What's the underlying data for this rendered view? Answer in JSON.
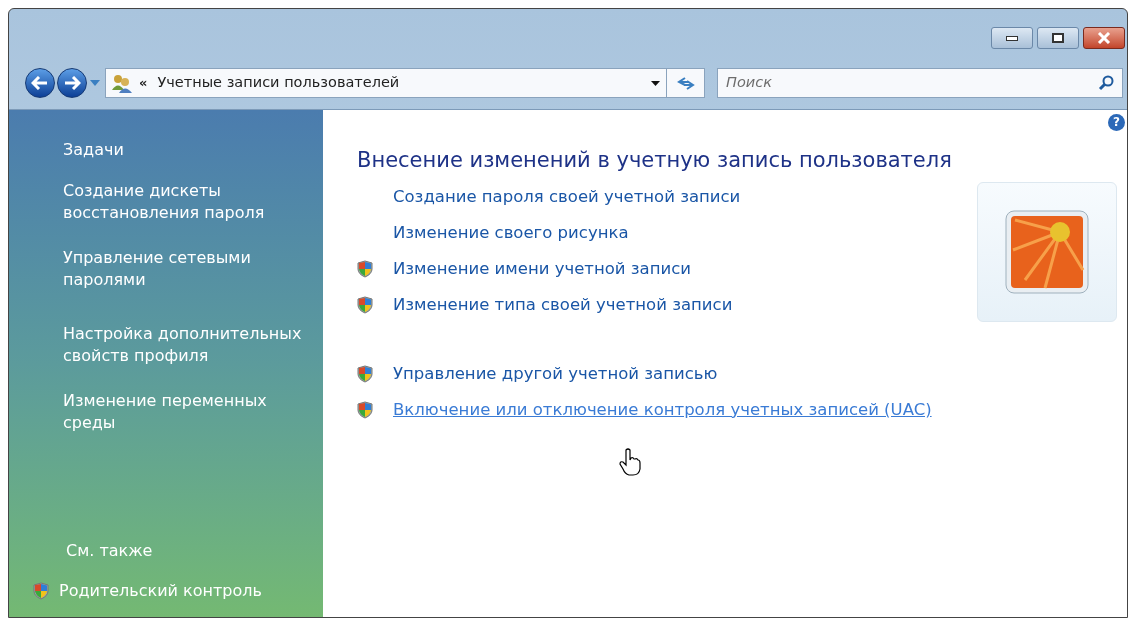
{
  "address_bar": {
    "path": "Учетные записи пользователей",
    "chevron": "«"
  },
  "search": {
    "placeholder": "Поиск"
  },
  "help_button": "?",
  "sidebar": {
    "heading": "Задачи",
    "items": [
      {
        "label": "Создание дискеты восстановления пароля"
      },
      {
        "label": "Управление сетевыми паролями"
      },
      {
        "label": "Настройка дополнительных свойств профиля"
      },
      {
        "label": "Изменение переменных среды"
      }
    ],
    "see_also": {
      "heading": "См. также",
      "items": [
        {
          "label": "Родительский контроль",
          "shield": true
        }
      ]
    }
  },
  "main": {
    "title": "Внесение изменений в учетную запись пользователя",
    "groups": [
      [
        {
          "label": "Создание пароля своей учетной записи",
          "shield": false,
          "hovered": false
        },
        {
          "label": "Изменение своего рисунка",
          "shield": false,
          "hovered": false
        },
        {
          "label": "Изменение имени учетной записи",
          "shield": true,
          "hovered": false
        },
        {
          "label": "Изменение типа своей учетной записи",
          "shield": true,
          "hovered": false
        }
      ],
      [
        {
          "label": "Управление другой учетной записью",
          "shield": true,
          "hovered": false
        },
        {
          "label": "Включение или отключение контроля учетных записей (UAC)",
          "shield": true,
          "hovered": true
        }
      ]
    ]
  }
}
